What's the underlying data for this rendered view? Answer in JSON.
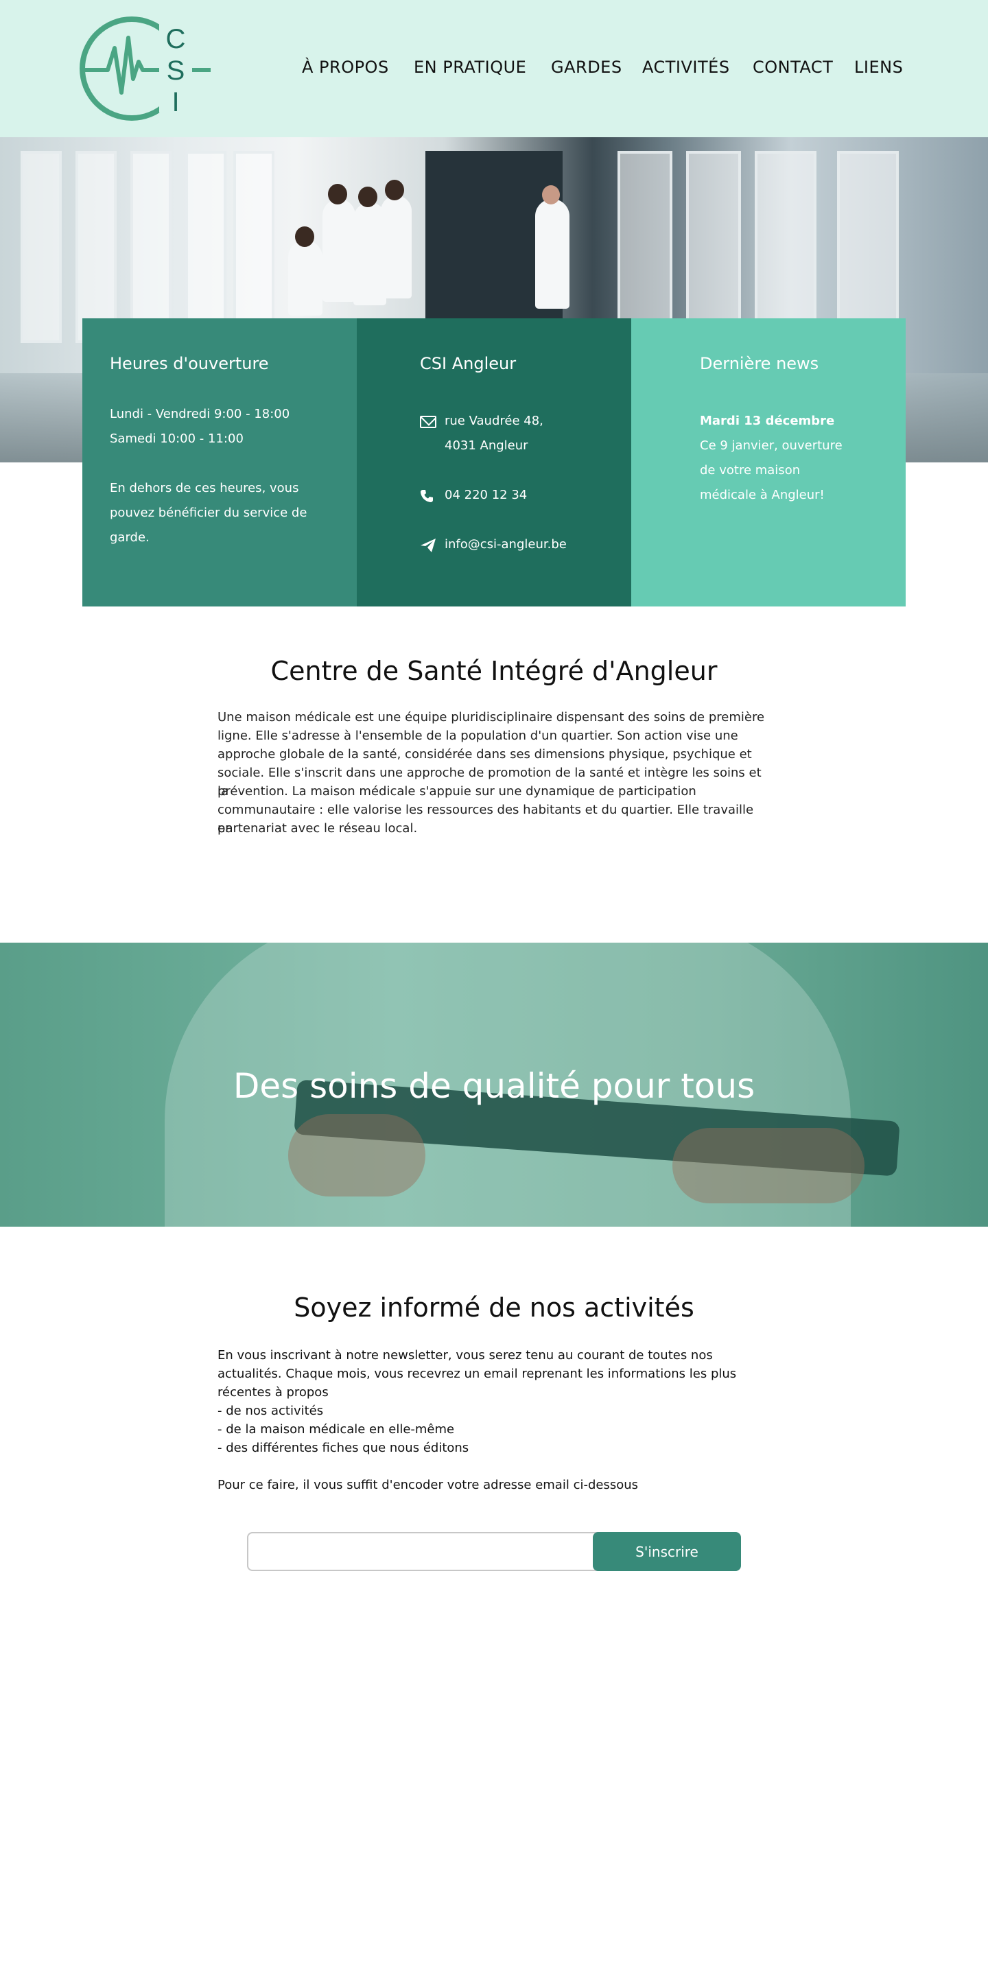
{
  "header": {
    "logo": {
      "letters": [
        "C",
        "S",
        "I"
      ],
      "color": "#4aa583"
    },
    "nav": [
      {
        "label": "À PROPOS"
      },
      {
        "label": "EN PRATIQUE"
      },
      {
        "label": "GARDES"
      },
      {
        "label": "ACTIVITÉS"
      },
      {
        "label": "CONTACT"
      },
      {
        "label": "LIENS"
      }
    ],
    "background": "#d8f3eb"
  },
  "info": {
    "hours": {
      "title": "Heures d'ouverture",
      "line1": "Lundi - Vendredi  9:00 - 18:00",
      "line2": "Samedi  10:00 - 11:00",
      "note1": "En dehors de ces heures, vous",
      "note2": "pouvez bénéficier du service de",
      "note3": "garde.",
      "color": "#378a79"
    },
    "address": {
      "title": "CSI Angleur",
      "street": "rue Vaudrée 48,",
      "city": "4031 Angleur",
      "phone": "04 220 12 34",
      "email": "info@csi-angleur.be",
      "icons": [
        "envelope-icon",
        "phone-icon",
        "paper-plane-icon"
      ],
      "color": "#1f6e5d"
    },
    "news": {
      "title": "Dernière news",
      "date": "Mardi 13 décembre",
      "text1": "Ce 9 janvier, ouverture",
      "text2": "de votre maison",
      "text3": "médicale à Angleur!",
      "color": "#66cbb3"
    }
  },
  "about": {
    "title": "Centre de Santé Intégré d'Angleur",
    "lines": [
      "Une maison médicale est une équipe pluridisciplinaire dispensant des soins de première",
      "ligne. Elle s'adresse à l'ensemble de la population d'un quartier. Son action vise une",
      "approche globale de la santé, considérée dans ses dimensions physique, psychique et",
      "sociale. Elle s'inscrit dans une approche de promotion de la santé et intègre les soins et la",
      "prévention. La maison médicale s'appuie sur une dynamique de participation",
      "communautaire : elle valorise les ressources des habitants et du quartier. Elle travaille en",
      "partenariat avec le réseau local."
    ]
  },
  "banner": {
    "title": "Des soins de qualité pour tous"
  },
  "newsletter": {
    "title": "Soyez informé de nos activités",
    "lines": [
      "En vous inscrivant à notre newsletter, vous serez tenu au courant de toutes nos",
      "actualités. Chaque mois, vous recevrez un email reprenant les informations les plus",
      "récentes à propos",
      "- de nos activités",
      "- de la maison médicale en elle-même",
      "- des différentes fiches que nous éditons"
    ],
    "instruction": "Pour ce faire, il vous suffit d'encoder votre adresse email ci-dessous",
    "input_value": "",
    "button_label": "S'inscrire"
  }
}
